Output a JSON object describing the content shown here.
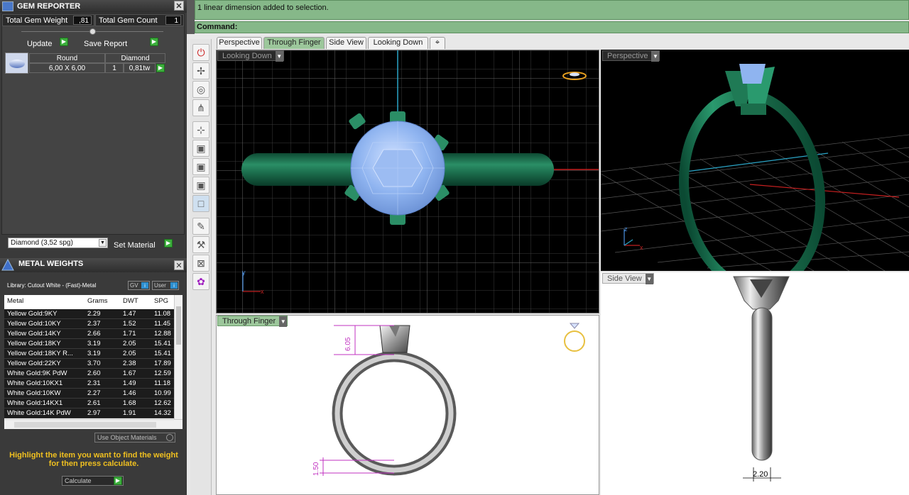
{
  "gem_reporter": {
    "title": "GEM REPORTER",
    "total_weight_label": "Total Gem Weight",
    "total_weight_value": ",81",
    "total_count_label": "Total Gem Count",
    "total_count_value": "1",
    "update_label": "Update",
    "save_report_label": "Save Report",
    "gem_cut": "Round",
    "gem_type": "Diamond",
    "gem_size": "6,00 X 6,00",
    "gem_qty": "1",
    "gem_weight": "0,81tw",
    "material_select": "Diamond    (3,52 spg)",
    "set_material_label": "Set Material"
  },
  "metal_weights": {
    "title": "METAL WEIGHTS",
    "library": "Library: Cutout White - (Fast)-Metal",
    "gv_label": "GV",
    "user_label": "User",
    "headers": [
      "Metal",
      "Grams",
      "DWT",
      "SPG"
    ],
    "rows": [
      [
        "Yellow Gold:9KY",
        "2.29",
        "1.47",
        "11.08"
      ],
      [
        "Yellow Gold:10KY",
        "2.37",
        "1.52",
        "11.45"
      ],
      [
        "Yellow Gold:14KY",
        "2.66",
        "1.71",
        "12.88"
      ],
      [
        "Yellow Gold:18KY",
        "3.19",
        "2.05",
        "15.41"
      ],
      [
        "Yellow Gold:18KY R...",
        "3.19",
        "2.05",
        "15.41"
      ],
      [
        "Yellow Gold:22KY",
        "3.70",
        "2.38",
        "17.89"
      ],
      [
        "White Gold:9K PdW",
        "2.60",
        "1.67",
        "12.59"
      ],
      [
        "White Gold:10KX1",
        "2.31",
        "1.49",
        "11.18"
      ],
      [
        "White Gold:10KW",
        "2.27",
        "1.46",
        "10.99"
      ],
      [
        "White Gold:14KX1",
        "2.61",
        "1.68",
        "12.62"
      ],
      [
        "White Gold:14K PdW",
        "2.97",
        "1.91",
        "14.32"
      ]
    ],
    "use_object_materials": "Use Object Materials",
    "hint": "Highlight the item you want to find the weight for then press calculate.",
    "calculate_label": "Calculate"
  },
  "command": {
    "history": "1 linear dimension added to selection.",
    "prompt": "Command:"
  },
  "tabs": [
    "Perspective",
    "Through Finger",
    "Side View",
    "Looking Down"
  ],
  "viewports": {
    "top_left": "Looking Down",
    "top_right": "Perspective",
    "bottom_left": "Through Finger",
    "bottom_right": "Side View"
  },
  "dimensions": {
    "height": "6.05",
    "band": "1.50",
    "width": "2.20"
  },
  "axis": {
    "x": "x",
    "y": "y",
    "z": "z"
  },
  "colors": {
    "ring_green": "#1f7a55",
    "gem_blue": "#8fb4f0",
    "cmd_green": "#86b889",
    "button_green": "#3cae3c"
  }
}
